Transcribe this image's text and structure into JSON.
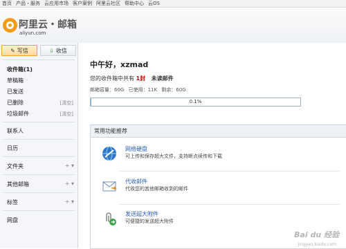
{
  "topnav": [
    "首页",
    "产品・服务",
    "云应用市场",
    "客户案例",
    "阿里云社区",
    "帮助中心",
    "云OS"
  ],
  "logo": {
    "brand": "阿里云・邮箱",
    "domain": "aliyun.com"
  },
  "actions": {
    "write": "写信",
    "receive": "收信"
  },
  "folders": [
    {
      "label": "收件箱(1)",
      "tag": ""
    },
    {
      "label": "草稿箱",
      "tag": ""
    },
    {
      "label": "已发送",
      "tag": ""
    },
    {
      "label": "已删除",
      "tag": "[清空]"
    },
    {
      "label": "垃圾邮件",
      "tag": "[清空]"
    }
  ],
  "sections": {
    "contacts": "联系人",
    "calendar": "日历",
    "files": "文件夹",
    "other_mail": "其他邮箱",
    "labels": "标签",
    "netdisk": "网盘",
    "plus": "+ ▾"
  },
  "main": {
    "greeting": "中午好，xzmad",
    "summary_prefix": "您的收件箱中共有",
    "unread_count": "1封",
    "unread_label": "未读邮件",
    "quota": {
      "capacity": "邮箱容量：60G",
      "used": "已使用：11K",
      "remaining": "剩余：60G"
    },
    "progress": {
      "value": 0.001,
      "label": "0.1%"
    },
    "recommend_title": "常用功能推荐",
    "features": [
      {
        "icon": "globe-disk-icon",
        "title": "网络硬盘",
        "desc": "可上传和保存超大文件，支持断点续传和下载"
      },
      {
        "icon": "mail-collect-icon",
        "title": "代收邮件",
        "desc": "代收您的其他邮箱收到的邮件"
      },
      {
        "icon": "attachment-send-icon",
        "title": "发送超大附件",
        "desc": "可便捷的发送超大附件"
      }
    ]
  },
  "watermark": {
    "main": "Bai du 经验",
    "sub": "jingyan.baidu.com"
  },
  "colors": {
    "accent": "#f39a17",
    "link": "#2a5db0",
    "unread": "#cc0000"
  }
}
